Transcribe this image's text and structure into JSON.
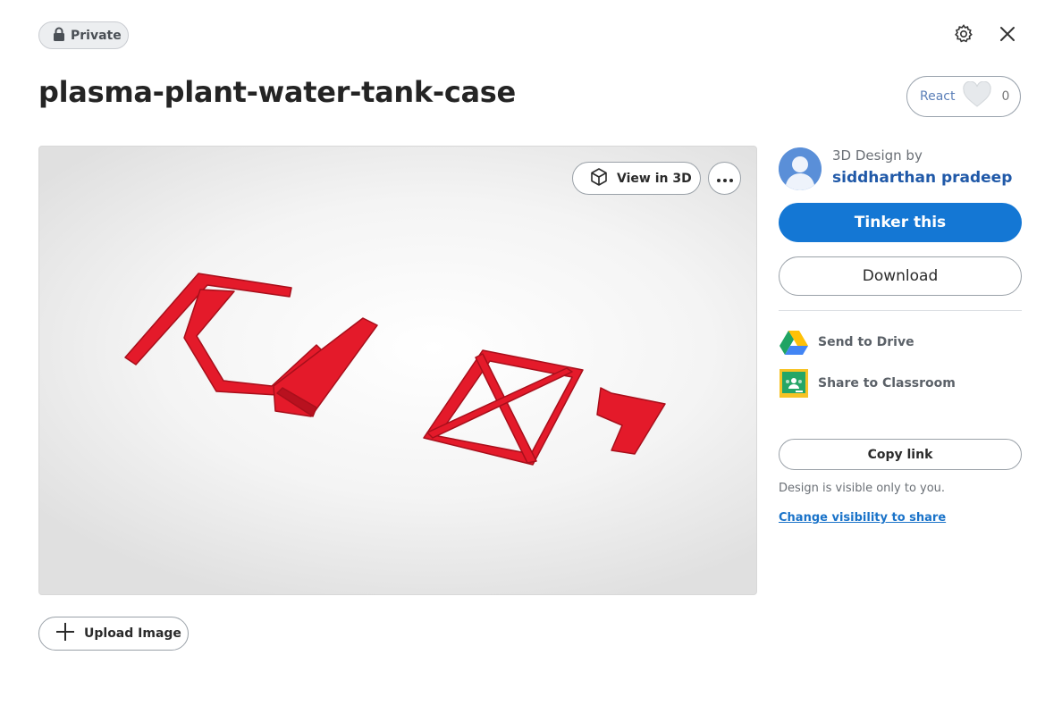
{
  "header": {
    "privacy_label": "Private",
    "title": "plasma-plant-water-tank-case",
    "react_label": "React",
    "react_count": "0"
  },
  "preview": {
    "view3d_label": "View in 3D",
    "upload_label": "Upload Image",
    "model_color": "#e41a2a"
  },
  "sidebar": {
    "by_label": "3D Design by",
    "author": "siddharthan pradeep",
    "tinker_label": "Tinker this",
    "download_label": "Download",
    "send_drive_label": "Send to Drive",
    "share_classroom_label": "Share to Classroom",
    "copy_link_label": "Copy link",
    "visibility_note": "Design is visible only to you.",
    "change_visibility_label": "Change visibility to share"
  },
  "icons": [
    "lock-icon",
    "gear-icon",
    "close-icon",
    "heart-icon",
    "cube-icon",
    "more-icon",
    "plus-icon",
    "avatar-icon",
    "google-drive-icon",
    "google-classroom-icon"
  ],
  "colors": {
    "accent": "#1477d4",
    "link": "#1a73c9",
    "author": "#2059a8"
  }
}
